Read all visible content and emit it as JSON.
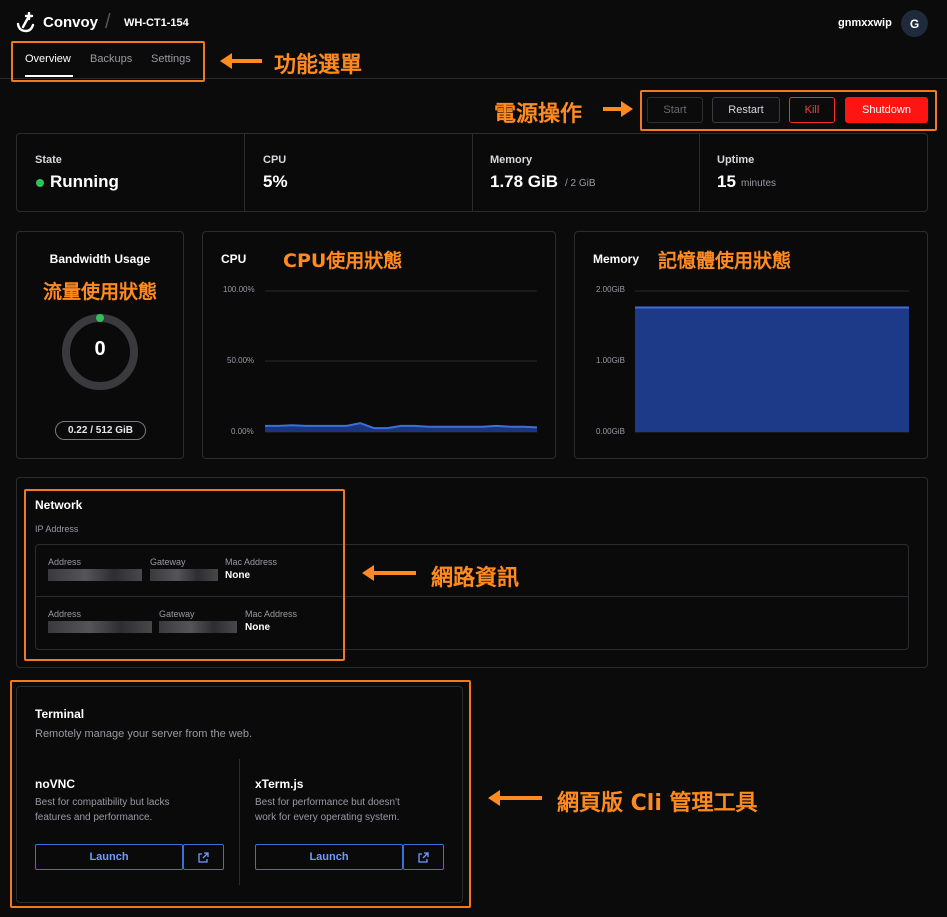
{
  "header": {
    "brand": "Convoy",
    "server": "WH-CT1-154",
    "user": "gnmxxwip",
    "avatar": "G"
  },
  "tabs": [
    {
      "label": "Overview",
      "active": true
    },
    {
      "label": "Backups",
      "active": false
    },
    {
      "label": "Settings",
      "active": false
    }
  ],
  "power": {
    "start": "Start",
    "restart": "Restart",
    "kill": "Kill",
    "shutdown": "Shutdown"
  },
  "stats": {
    "state_label": "State",
    "state_value": "Running",
    "cpu_label": "CPU",
    "cpu_value": "5%",
    "memory_label": "Memory",
    "memory_value": "1.78 GiB",
    "memory_total": "/ 2 GiB",
    "uptime_label": "Uptime",
    "uptime_value": "15",
    "uptime_unit": "minutes"
  },
  "bandwidth": {
    "title": "Bandwidth Usage",
    "value": "0",
    "usage": "0.22 / 512 GiB"
  },
  "cpu_chart": {
    "title": "CPU",
    "ticks": [
      "100.00%",
      "50.00%",
      "0.00%"
    ]
  },
  "memory_chart": {
    "title": "Memory",
    "ticks": [
      "2.00GiB",
      "1.00GiB",
      "0.00GiB"
    ]
  },
  "network": {
    "title": "Network",
    "subtitle": "IP Address",
    "address_label": "Address",
    "gateway_label": "Gateway",
    "mac_label": "Mac Address",
    "mac1": "None",
    "mac2": "None"
  },
  "terminal": {
    "title": "Terminal",
    "subtitle": "Remotely manage your server from the web.",
    "novnc_title": "noVNC",
    "novnc_desc1": "Best for compatibility but lacks",
    "novnc_desc2": "features and performance.",
    "xterm_title": "xTerm.js",
    "xterm_desc1": "Best for performance but doesn't",
    "xterm_desc2": "work for every operating system.",
    "launch": "Launch"
  },
  "annotations": {
    "menu": "功能選單",
    "power": "電源操作",
    "bandwidth": "流量使用狀態",
    "cpu": "CPU使用狀態",
    "memory": "記憶體使用狀態",
    "network": "網路資訊",
    "terminal": "網頁版 Cli 管理工具"
  },
  "colors": {
    "accent": "#ff8a1f",
    "running": "#2fc15a",
    "kill": "#ff2a2a",
    "chart_line": "#3d6fd6",
    "chart_fill": "#1c3a87"
  },
  "chart_data": [
    {
      "type": "line",
      "title": "CPU",
      "ylim": [
        0,
        100
      ],
      "series": [
        {
          "values": [
            5,
            5,
            5.5,
            5,
            5,
            5,
            5,
            7,
            3.5,
            3.5,
            5,
            5,
            4.5,
            4.5,
            4.5,
            4.5,
            4.5,
            5,
            4.5,
            4.5,
            4
          ]
        }
      ]
    },
    {
      "type": "area",
      "title": "Memory",
      "ylim": [
        0,
        2
      ],
      "series": [
        {
          "values": [
            1.78,
            1.78
          ]
        }
      ]
    }
  ]
}
